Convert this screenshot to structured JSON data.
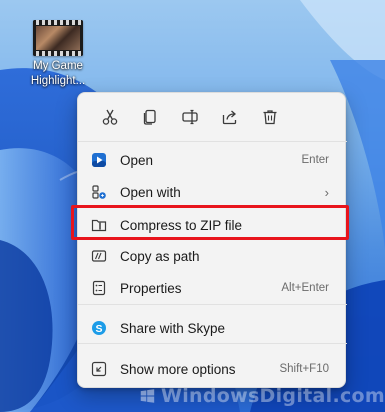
{
  "desktop": {
    "icon_label": "My Game Highlight..."
  },
  "toolbar": {
    "buttons": [
      "cut-icon",
      "copy-icon",
      "rename-icon",
      "share-icon",
      "delete-icon"
    ]
  },
  "menu": {
    "items": [
      {
        "label": "Open",
        "shortcut": "Enter",
        "icon": "media-player-icon"
      },
      {
        "label": "Open with",
        "shortcut": "",
        "icon": "open-with-icon",
        "submenu": "›"
      },
      {
        "label": "Compress to ZIP file",
        "shortcut": "",
        "icon": "zip-folder-icon"
      },
      {
        "label": "Copy as path",
        "shortcut": "",
        "icon": "copy-path-icon"
      },
      {
        "label": "Properties",
        "shortcut": "Alt+Enter",
        "icon": "properties-icon"
      },
      {
        "label": "Share with Skype",
        "shortcut": "",
        "icon": "skype-icon"
      },
      {
        "label": "Show more options",
        "shortcut": "Shift+F10",
        "icon": "more-options-icon"
      }
    ]
  },
  "watermark": {
    "text": "WindowsDigital.com"
  },
  "colors": {
    "highlight_border": "#e8141c",
    "menu_bg": "#f3f3f3",
    "accent": "#0067c0"
  }
}
